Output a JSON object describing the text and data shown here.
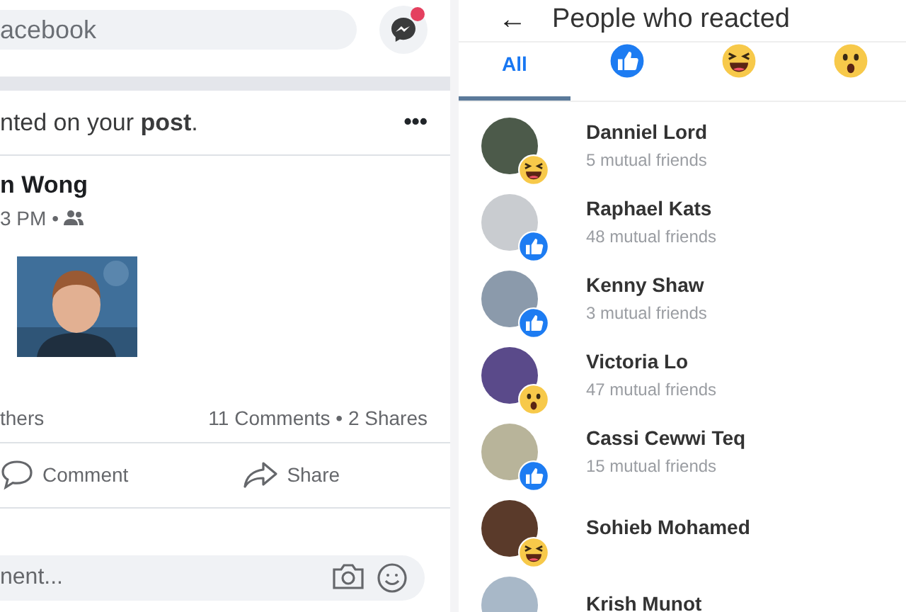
{
  "feed": {
    "search": {
      "placeholder": "acebook"
    },
    "notification": {
      "text": "nted on your **post**.",
      "more": "•••"
    },
    "post": {
      "author": "n Wong",
      "time": "3 PM •",
      "reactions_text": "thers",
      "counts": "11 Comments • 2 Shares"
    },
    "actions": [
      {
        "label": "Comment",
        "kind": "comment"
      },
      {
        "label": "Share",
        "kind": "share"
      }
    ],
    "comment_field": {
      "placeholder": "nent..."
    }
  },
  "reactions": {
    "title": "People who reacted",
    "back": "←",
    "tabs": [
      {
        "kind": "all",
        "label": "All",
        "selected": true
      },
      {
        "kind": "like",
        "selected": false
      },
      {
        "kind": "haha",
        "selected": false
      },
      {
        "kind": "wow",
        "selected": false
      }
    ],
    "people": [
      {
        "name": "Danniel Lord",
        "mutual": "5 mutual friends",
        "reaction": {
          "kind": "haha"
        }
      },
      {
        "name": "Raphael Kats",
        "mutual": "48 mutual friends",
        "reaction": {
          "kind": "like"
        }
      },
      {
        "name": "Kenny Shaw",
        "mutual": "3 mutual friends",
        "reaction": {
          "kind": "like"
        }
      },
      {
        "name": "Victoria Lo",
        "mutual": "47 mutual friends",
        "reaction": {
          "kind": "wow"
        }
      },
      {
        "name": "Cassi Cewwi Teq",
        "mutual": "15 mutual friends",
        "reaction": {
          "kind": "like"
        }
      },
      {
        "name": "Sohieb Mohamed",
        "reaction": {
          "kind": "haha"
        }
      },
      {
        "name": "Krish Munot"
      }
    ]
  }
}
